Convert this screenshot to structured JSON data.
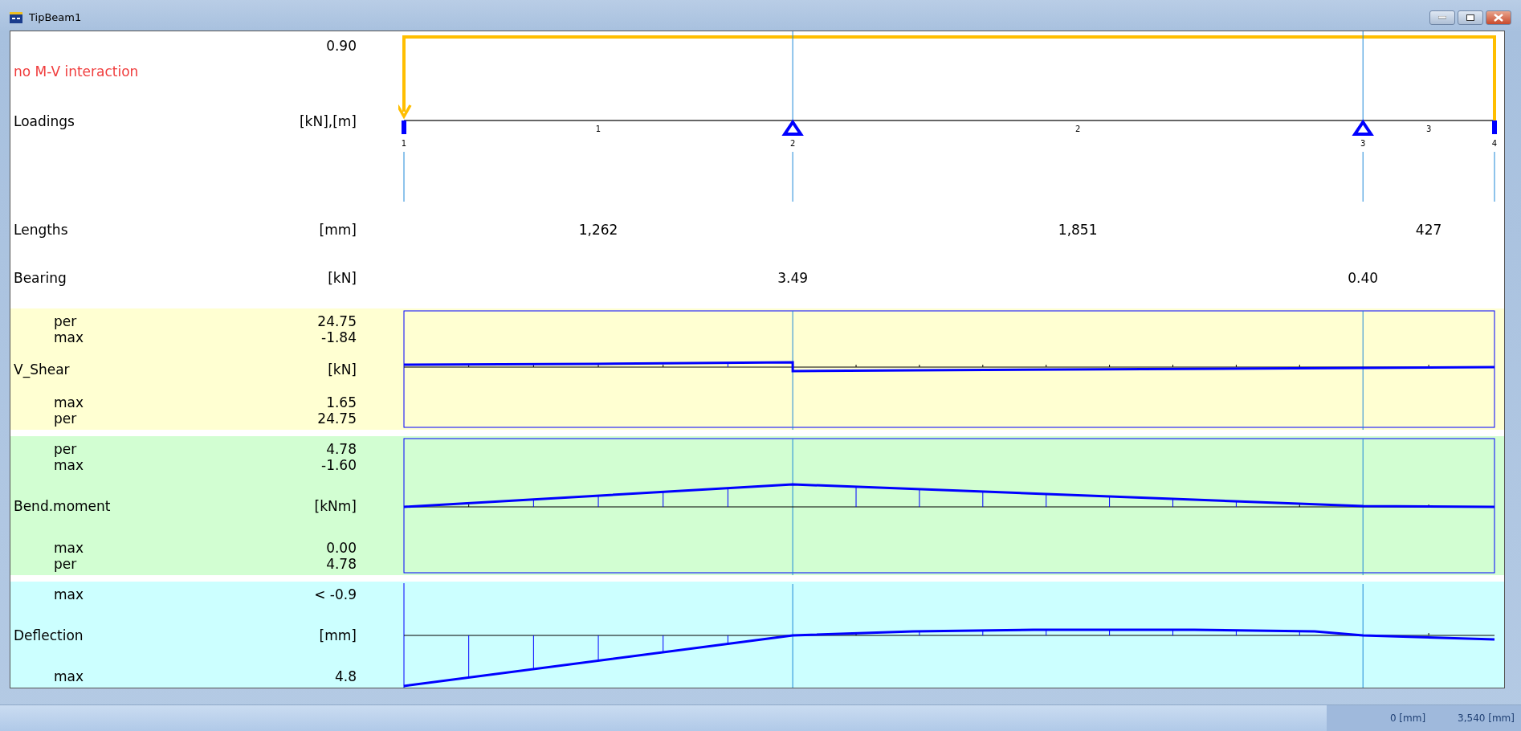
{
  "window": {
    "title": "TipBeam1"
  },
  "header": {
    "factor": "0.90",
    "note": "no M-V interaction"
  },
  "loadings": {
    "label": "Loadings",
    "unit": "[kN],[m]",
    "nodes": [
      {
        "label": "1",
        "support": false
      },
      {
        "label": "2",
        "support": true
      },
      {
        "label": "3",
        "support": true
      },
      {
        "label": "4",
        "support": false
      }
    ],
    "spans": [
      "1",
      "2",
      "3"
    ]
  },
  "lengths": {
    "label": "Lengths",
    "unit": "[mm]",
    "values": [
      "1,262",
      "1,851",
      "427"
    ]
  },
  "bearing": {
    "label": "Bearing",
    "unit": "[kN]",
    "values": [
      "3.49",
      "0.40"
    ]
  },
  "diagrams": [
    {
      "kind": "shear",
      "color": "#ffffd2",
      "label": "V_Shear",
      "unit": "[kN]",
      "top": [
        {
          "label": "per",
          "value": "24.75"
        },
        {
          "label": "max",
          "value": "-1.84"
        }
      ],
      "bottom": [
        {
          "label": "max",
          "value": "1.65"
        },
        {
          "label": "per",
          "value": "24.75"
        }
      ]
    },
    {
      "kind": "moment",
      "color": "#d2fed2",
      "label": "Bend.moment",
      "unit": "[kNm]",
      "top": [
        {
          "label": "per",
          "value": "4.78"
        },
        {
          "label": "max",
          "value": "-1.60"
        }
      ],
      "bottom": [
        {
          "label": "max",
          "value": "0.00"
        },
        {
          "label": "per",
          "value": "4.78"
        }
      ]
    },
    {
      "kind": "deflection",
      "color": "#ccffff",
      "label": "Deflection",
      "unit": "[mm]",
      "top": [
        {
          "label": "max",
          "value": "< -0.9"
        }
      ],
      "bottom": [
        {
          "label": "max",
          "value": "4.8"
        }
      ]
    }
  ],
  "status_bar": {
    "start": "0 [mm]",
    "end": "3,540 [mm]"
  }
}
